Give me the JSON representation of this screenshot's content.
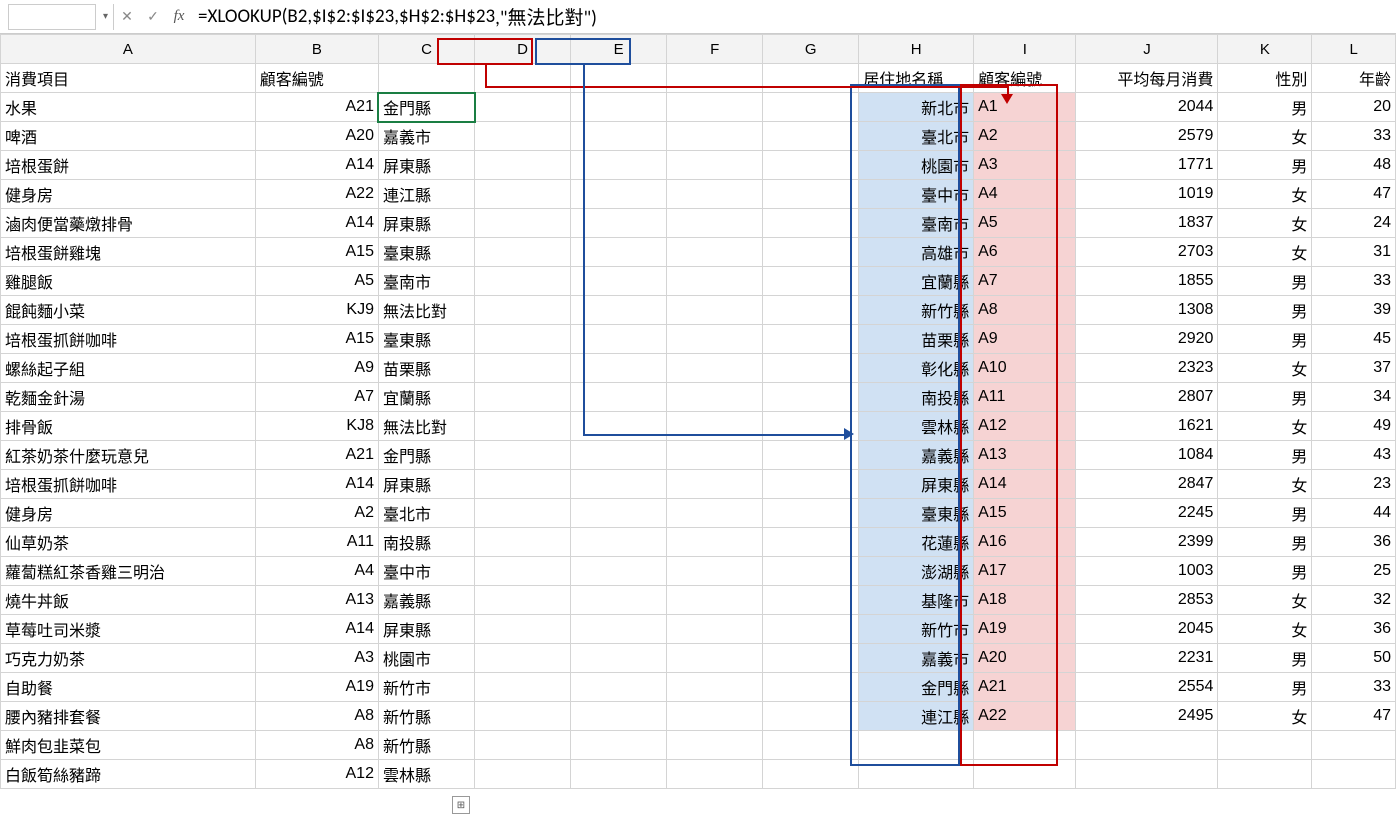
{
  "formula_bar": {
    "name_box": "",
    "fx_label": "fx",
    "formula_prefix": "=XLOOKUP(B2,",
    "formula_red": "$I$2:$I$23",
    "formula_mid": ",",
    "formula_blue": "$H$2:$H$23",
    "formula_suffix": ",\"無法比對\")"
  },
  "columns": [
    "A",
    "B",
    "C",
    "D",
    "E",
    "F",
    "G",
    "H",
    "I",
    "J",
    "K",
    "L"
  ],
  "headers": {
    "A": "消費項目",
    "B": "顧客編號",
    "H": "居住地名稱",
    "I": "顧客編號",
    "J": "平均每月消費",
    "K": "性別",
    "L": "年齡"
  },
  "rows_left": [
    {
      "a": "水果",
      "b": "A21",
      "c": "金門縣"
    },
    {
      "a": "啤酒",
      "b": "A20",
      "c": "嘉義市"
    },
    {
      "a": "培根蛋餅",
      "b": "A14",
      "c": "屏東縣"
    },
    {
      "a": "健身房",
      "b": "A22",
      "c": "連江縣"
    },
    {
      "a": "滷肉便當藥燉排骨",
      "b": "A14",
      "c": "屏東縣"
    },
    {
      "a": "培根蛋餅雞塊",
      "b": "A15",
      "c": "臺東縣"
    },
    {
      "a": "雞腿飯",
      "b": "A5",
      "c": "臺南市"
    },
    {
      "a": "餛飩麵小菜",
      "b": "KJ9",
      "c": "無法比對"
    },
    {
      "a": "培根蛋抓餅咖啡",
      "b": "A15",
      "c": "臺東縣"
    },
    {
      "a": "螺絲起子組",
      "b": "A9",
      "c": "苗栗縣"
    },
    {
      "a": "乾麵金針湯",
      "b": "A7",
      "c": "宜蘭縣"
    },
    {
      "a": "排骨飯",
      "b": "KJ8",
      "c": "無法比對"
    },
    {
      "a": "紅茶奶茶什麼玩意兒",
      "b": "A21",
      "c": "金門縣"
    },
    {
      "a": "培根蛋抓餅咖啡",
      "b": "A14",
      "c": "屏東縣"
    },
    {
      "a": "健身房",
      "b": "A2",
      "c": "臺北市"
    },
    {
      "a": "仙草奶茶",
      "b": "A11",
      "c": "南投縣"
    },
    {
      "a": "蘿蔔糕紅茶香雞三明治",
      "b": "A4",
      "c": "臺中市"
    },
    {
      "a": "燒牛丼飯",
      "b": "A13",
      "c": "嘉義縣"
    },
    {
      "a": "草莓吐司米漿",
      "b": "A14",
      "c": "屏東縣"
    },
    {
      "a": "巧克力奶茶",
      "b": "A3",
      "c": "桃園市"
    },
    {
      "a": "自助餐",
      "b": "A19",
      "c": "新竹市"
    },
    {
      "a": "腰內豬排套餐",
      "b": "A8",
      "c": "新竹縣"
    },
    {
      "a": "鮮肉包韭菜包",
      "b": "A8",
      "c": "新竹縣"
    },
    {
      "a": "白飯筍絲豬蹄",
      "b": "A12",
      "c": "雲林縣"
    }
  ],
  "rows_right": [
    {
      "h": "新北市",
      "i": "A1",
      "j": "2044",
      "k": "男",
      "l": "20"
    },
    {
      "h": "臺北市",
      "i": "A2",
      "j": "2579",
      "k": "女",
      "l": "33"
    },
    {
      "h": "桃園市",
      "i": "A3",
      "j": "1771",
      "k": "男",
      "l": "48"
    },
    {
      "h": "臺中市",
      "i": "A4",
      "j": "1019",
      "k": "女",
      "l": "47"
    },
    {
      "h": "臺南市",
      "i": "A5",
      "j": "1837",
      "k": "女",
      "l": "24"
    },
    {
      "h": "高雄市",
      "i": "A6",
      "j": "2703",
      "k": "女",
      "l": "31"
    },
    {
      "h": "宜蘭縣",
      "i": "A7",
      "j": "1855",
      "k": "男",
      "l": "33"
    },
    {
      "h": "新竹縣",
      "i": "A8",
      "j": "1308",
      "k": "男",
      "l": "39"
    },
    {
      "h": "苗栗縣",
      "i": "A9",
      "j": "2920",
      "k": "男",
      "l": "45"
    },
    {
      "h": "彰化縣",
      "i": "A10",
      "j": "2323",
      "k": "女",
      "l": "37"
    },
    {
      "h": "南投縣",
      "i": "A11",
      "j": "2807",
      "k": "男",
      "l": "34"
    },
    {
      "h": "雲林縣",
      "i": "A12",
      "j": "1621",
      "k": "女",
      "l": "49"
    },
    {
      "h": "嘉義縣",
      "i": "A13",
      "j": "1084",
      "k": "男",
      "l": "43"
    },
    {
      "h": "屏東縣",
      "i": "A14",
      "j": "2847",
      "k": "女",
      "l": "23"
    },
    {
      "h": "臺東縣",
      "i": "A15",
      "j": "2245",
      "k": "男",
      "l": "44"
    },
    {
      "h": "花蓮縣",
      "i": "A16",
      "j": "2399",
      "k": "男",
      "l": "36"
    },
    {
      "h": "澎湖縣",
      "i": "A17",
      "j": "1003",
      "k": "男",
      "l": "25"
    },
    {
      "h": "基隆市",
      "i": "A18",
      "j": "2853",
      "k": "女",
      "l": "32"
    },
    {
      "h": "新竹市",
      "i": "A19",
      "j": "2045",
      "k": "女",
      "l": "36"
    },
    {
      "h": "嘉義市",
      "i": "A20",
      "j": "2231",
      "k": "男",
      "l": "50"
    },
    {
      "h": "金門縣",
      "i": "A21",
      "j": "2554",
      "k": "男",
      "l": "33"
    },
    {
      "h": "連江縣",
      "i": "A22",
      "j": "2495",
      "k": "女",
      "l": "47"
    }
  ],
  "icons": {
    "dropdown": "▾",
    "cancel": "✕",
    "enter": "✓",
    "autofill": "⊞"
  }
}
